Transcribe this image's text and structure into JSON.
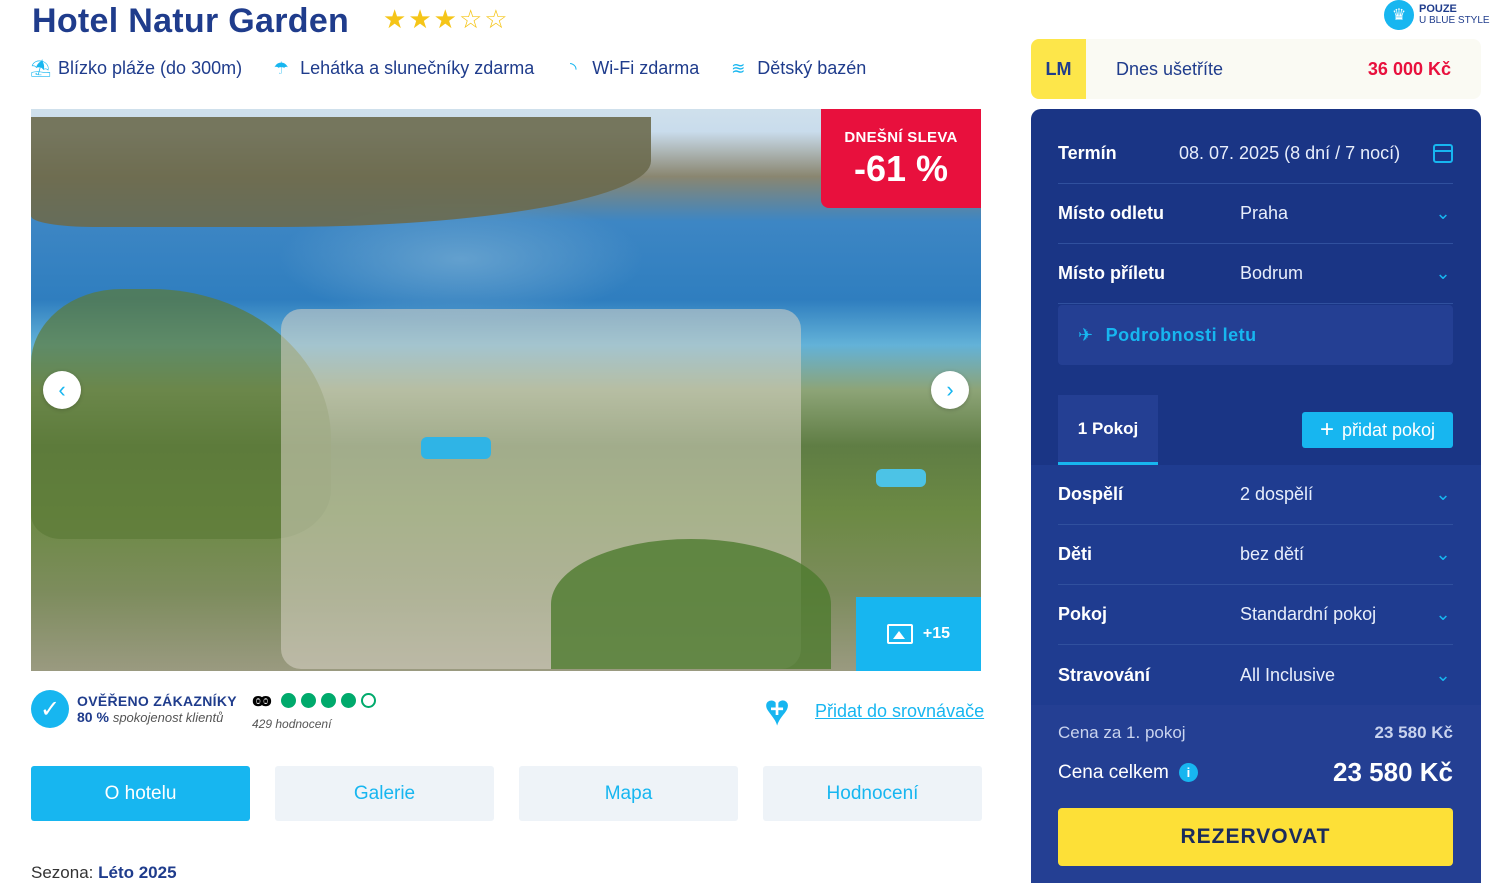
{
  "hotel": {
    "name": "Hotel Natur Garden",
    "stars_filled": 3,
    "stars_total": 5
  },
  "badge": {
    "line1": "POUZE",
    "line2": "U BLUE STYLE",
    "icon": "crown-icon"
  },
  "amenities": [
    {
      "icon": "beach-umbrella-icon",
      "label": "Blízko pláže (do 300m)"
    },
    {
      "icon": "sunbed-icon",
      "label": "Lehátka a slunečníky zdarma"
    },
    {
      "icon": "wifi-icon",
      "label": "Wi-Fi zdarma"
    },
    {
      "icon": "kids-pool-icon",
      "label": "Dětský bazén"
    }
  ],
  "photo": {
    "sale_label": "DNEŠNÍ SLEVA",
    "sale_value": "-61 %",
    "more_photos": "+15"
  },
  "verified": {
    "title": "OVĚŘENO ZÁKAZNÍKY",
    "percent": "80 %",
    "percent_text": "spokojenost klientů"
  },
  "tripadvisor": {
    "rating": 4,
    "rating_max": 5,
    "count_text": "429 hodnocení"
  },
  "compare": {
    "label": "Přidat do srovnávače"
  },
  "tabs": [
    {
      "label": "O hotelu",
      "active": true
    },
    {
      "label": "Galerie",
      "active": false
    },
    {
      "label": "Mapa",
      "active": false
    },
    {
      "label": "Hodnocení",
      "active": false
    }
  ],
  "season": {
    "label": "Sezona:",
    "value": "Léto 2025"
  },
  "lastminute": {
    "tag": "LM",
    "label": "Dnes ušetříte",
    "value": "36 000 Kč"
  },
  "booking": {
    "term_label": "Termín",
    "term_value": "08. 07. 2025 (8 dní / 7 nocí)",
    "departure_label": "Místo odletu",
    "departure_value": "Praha",
    "arrival_label": "Místo příletu",
    "arrival_value": "Bodrum",
    "flight_details": "Podrobnosti letu",
    "room_tab": "1 Pokoj",
    "add_room": "přidat pokoj",
    "adults_label": "Dospělí",
    "adults_value": "2 dospělí",
    "children_label": "Děti",
    "children_value": "bez dětí",
    "room_label": "Pokoj",
    "room_value": "Standardní pokoj",
    "board_label": "Stravování",
    "board_value": "All Inclusive",
    "price_room_label": "Cena za 1. pokoj",
    "price_room_value": "23 580 Kč",
    "price_total_label": "Cena celkem",
    "price_total_value": "23 580 Kč",
    "reserve_label": "REZERVOVAT"
  },
  "colors": {
    "brand_blue": "#1f3c8c",
    "accent_cyan": "#17b6f0",
    "sale_red": "#e8103d",
    "star_yellow": "#f5c518",
    "reserve_yellow": "#fde037",
    "tripadvisor_green": "#00aa6c"
  }
}
